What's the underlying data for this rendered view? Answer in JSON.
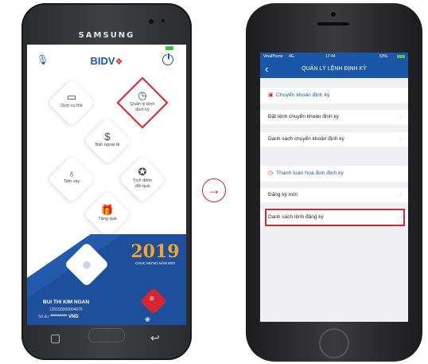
{
  "samsung": {
    "brand": "SAMSUNG",
    "app_logo": "BIDV",
    "tiles": {
      "card": "Dịch vụ thẻ",
      "schedule_line1": "Quản lý lệnh",
      "schedule_line2": "định kỳ",
      "forex": "Bán ngoại tệ",
      "loan": "Tiền vay",
      "points_line1": "Tích điểm",
      "points_line2": "đổi quà",
      "gift": "Tặng quà"
    },
    "promo": {
      "year": "2019",
      "caption": "CHÚC MỪNG NĂM MỚI"
    },
    "account": {
      "name": "BUI THI KIM NGAN",
      "number": "120150000004676",
      "balance_label": "Số dư",
      "balance_mask": "*********",
      "currency": "VND"
    },
    "icons": [
      "mic-icon",
      "power-icon",
      "card-icon",
      "clock-icon",
      "currency-icon",
      "money-bag-icon",
      "medal-icon",
      "gift-icon",
      "avatar",
      "menu-icon",
      "eye-icon",
      "recent-apps-icon",
      "back-icon"
    ]
  },
  "arrow": "→",
  "iphone": {
    "status": {
      "carrier": "VinaPhone",
      "network": "4G",
      "time": "17:44",
      "battery": "53%"
    },
    "title": "QUẢN LÝ LỆNH ĐỊNH KỲ",
    "sections": [
      {
        "title": "Chuyển khoản định kỳ",
        "rows": [
          "Đặt lệnh chuyển khoản định kỳ",
          "Danh sách chuyển khoản định kỳ"
        ]
      },
      {
        "title": "Thanh toán hoá đơn định kỳ",
        "rows": [
          "Đăng ký mới",
          "Danh sách lệnh đăng ký"
        ]
      }
    ],
    "highlight_color": "#d7262e",
    "brand_blue": "#1a57a8"
  }
}
